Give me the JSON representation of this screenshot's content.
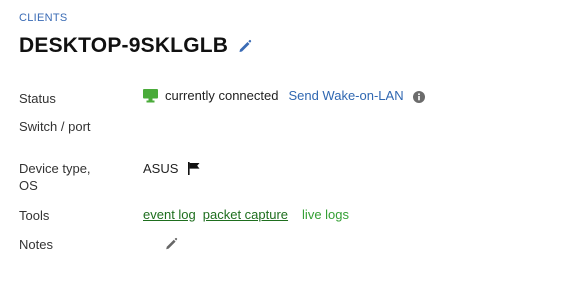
{
  "breadcrumb": {
    "label": "CLIENTS"
  },
  "header": {
    "title": "DESKTOP-9SKLGLB"
  },
  "fields": {
    "status": {
      "label": "Status",
      "value": "currently connected",
      "action": "Send Wake-on-LAN"
    },
    "switch_port": {
      "label": "Switch / port",
      "value": ""
    },
    "device_type": {
      "label_line1": "Device type,",
      "label_line2": "OS",
      "value": "ASUS"
    },
    "tools": {
      "label": "Tools",
      "links": [
        "event log",
        "packet capture",
        "live logs"
      ]
    },
    "notes": {
      "label": "Notes",
      "value": ""
    }
  },
  "colors": {
    "link_blue": "#2f67b1",
    "status_green": "#4aab3a",
    "tool_link_green": "#1e6e1e",
    "live_logs_green": "#35a035"
  },
  "icons": {
    "title_edit": "pencil-icon",
    "status": "monitor-icon",
    "info": "info-icon",
    "device": "flag-icon",
    "notes_edit": "pencil-icon"
  }
}
